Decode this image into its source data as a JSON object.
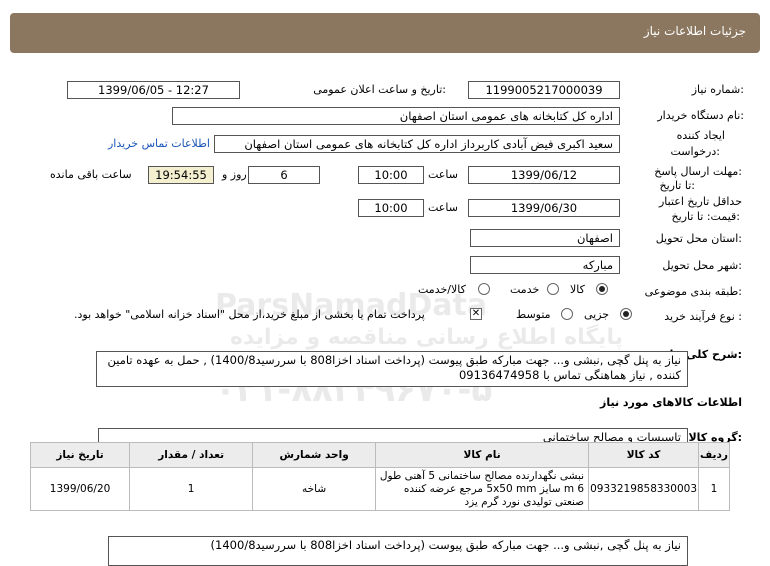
{
  "header": {
    "title": "جزئیات اطلاعات نیاز"
  },
  "fields": {
    "need_number_label": "شماره نیاز:",
    "need_number": "1199005217000039",
    "announce_label": "تاریخ و ساعت اعلان عمومی:",
    "announce_value": "1399/06/05 - 12:27",
    "buyer_label": "نام دستگاه خریدار:",
    "buyer_value": "اداره کل کتابخانه های عمومی استان اصفهان",
    "creator_label_1": "ایجاد کننده",
    "creator_label_2": "درخواست:",
    "creator_value": "سعید اکبری فیض آبادی کاربرداز اداره کل کتابخانه های عمومی استان اصفهان",
    "contact_link": "اطلاعات تماس خریدار",
    "deadline_label_1": "مهلت ارسال پاسخ:",
    "deadline_label_2": "تا تاریخ:",
    "deadline_date": "1399/06/12",
    "time_label": "ساعت",
    "deadline_time": "10:00",
    "days_value": "6",
    "days_label": "روز و",
    "countdown": "19:54:55",
    "remaining_label": "ساعت باقی مانده",
    "validity_label_1": "حداقل تاریخ اعتبار",
    "validity_label_2": "قیمت: تا تاریخ:",
    "validity_date": "1399/06/30",
    "validity_time": "10:00",
    "province_label": "استان محل تحویل:",
    "province_value": "اصفهان",
    "city_label": "شهر محل تحویل:",
    "city_value": "مبارکه",
    "category_label": "طبقه بندی موضوعی:",
    "category_options": [
      "کالا",
      "خدمت",
      "کالا/خدمت"
    ],
    "process_label": "نوع فرآیند خرید :",
    "process_options": [
      "جزیی",
      "متوسط"
    ],
    "payment_note": "پرداخت تمام یا بخشی از مبلغ خرید،از محل \"اسناد خزانه اسلامی\" خواهد بود.",
    "description_label": "شرح کلی نیاز:",
    "description": "نیاز به پنل گچی ,نبشی و... جهت مبارکه طبق پیوست (پرداخت اسناد اخزا808 با سررسید1400/8) , حمل به عهده تامین کننده , نیاز  هماهنگی تماس با 09136474958"
  },
  "goods": {
    "section_title": "اطلاعات کالاهای مورد نیاز",
    "group_label": "گروه کالا:",
    "group_value": "تاسیسات و مصالح ساختمانی",
    "columns": [
      "ردیف",
      "کد کالا",
      "نام کالا",
      "واحد شمارش",
      "تعداد / مقدار",
      "تاریخ نیاز"
    ],
    "rows": [
      {
        "row": "1",
        "code": "0933219858330003",
        "name": "نبشی نگهدارنده مصالح ساختمانی 5 آهنی طول 6 m سایز 5x50 mm مرجع عرضه کننده صنعتی تولیدی نورد گرم یزد",
        "unit": "شاخه",
        "qty": "1",
        "date": "1399/06/20"
      }
    ]
  },
  "bottom_preview": "نیاز به پنل گچی ,نبشی و... جهت مبارکه طبق پیوست (پرداخت اسناد اخزا808 با سررسید1400/8)",
  "watermark": {
    "line1": "ParsNamadData",
    "line2": "پایگاه اطلاع رسانی مناقصه و مزایده",
    "line3": "۰۲۱-۸۸۳۴۹۶۷۰-۵"
  }
}
